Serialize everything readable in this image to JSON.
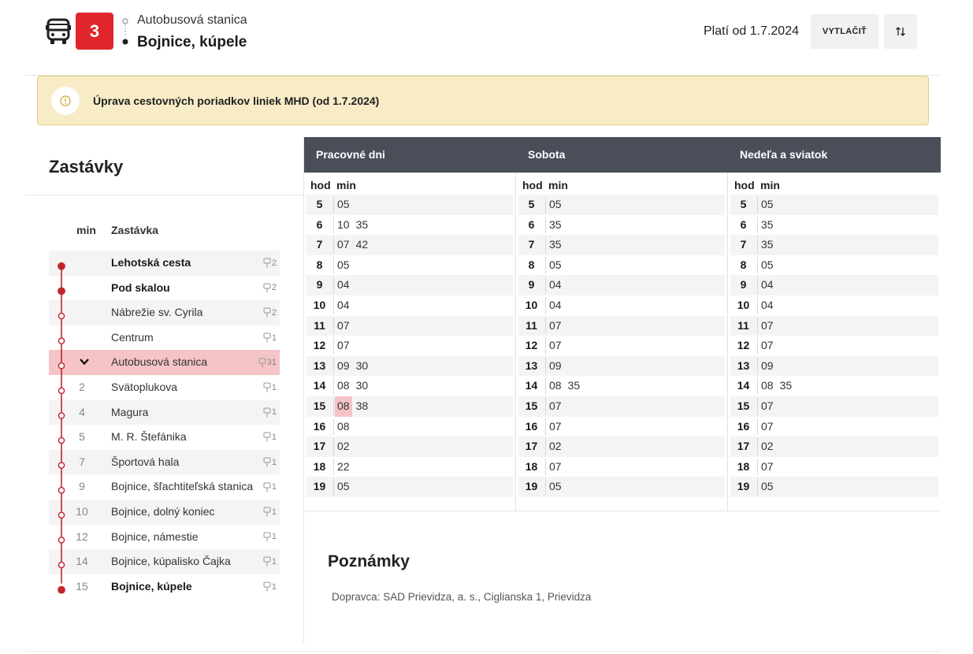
{
  "header": {
    "line_number": "3",
    "from_stop": "Autobusová stanica",
    "to_stop": "Bojnice, kúpele",
    "valid_from": "Platí od 1.7.2024",
    "print_label": "VYTLAČIŤ"
  },
  "notice": {
    "text": "Úprava cestovných poriadkov liniek MHD (od 1.7.2024)"
  },
  "stops": {
    "title": "Zastávky",
    "col_min": "min",
    "col_name": "Zastávka",
    "items": [
      {
        "min": "",
        "name": "Lehotská cesta",
        "platform": "2",
        "bold": true,
        "marker": "filled",
        "state": "past"
      },
      {
        "min": "",
        "name": "Pod skalou",
        "platform": "2",
        "bold": true,
        "marker": "filled",
        "state": "past"
      },
      {
        "min": "",
        "name": "Nábrežie sv. Cyrila",
        "platform": "2",
        "bold": false,
        "marker": "open",
        "state": "past"
      },
      {
        "min": "",
        "name": "Centrum",
        "platform": "1",
        "bold": false,
        "marker": "open",
        "state": "past"
      },
      {
        "min": "",
        "name": "Autobusová stanica",
        "platform": "31",
        "bold": false,
        "marker": "open",
        "state": "current"
      },
      {
        "min": "2",
        "name": "Svätoplukova",
        "platform": "1",
        "bold": false,
        "marker": "open",
        "state": "next"
      },
      {
        "min": "4",
        "name": "Magura",
        "platform": "1",
        "bold": false,
        "marker": "open",
        "state": "next"
      },
      {
        "min": "5",
        "name": "M. R. Štefánika",
        "platform": "1",
        "bold": false,
        "marker": "open",
        "state": "next"
      },
      {
        "min": "7",
        "name": "Športová hala",
        "platform": "1",
        "bold": false,
        "marker": "open",
        "state": "next"
      },
      {
        "min": "9",
        "name": "Bojnice, šľachtiteľská stanica",
        "platform": "1",
        "bold": false,
        "marker": "open",
        "state": "next"
      },
      {
        "min": "10",
        "name": "Bojnice, dolný koniec",
        "platform": "1",
        "bold": false,
        "marker": "open",
        "state": "next"
      },
      {
        "min": "12",
        "name": "Bojnice, námestie",
        "platform": "1",
        "bold": false,
        "marker": "open",
        "state": "next"
      },
      {
        "min": "14",
        "name": "Bojnice, kúpalisko Čajka",
        "platform": "1",
        "bold": false,
        "marker": "open",
        "state": "next"
      },
      {
        "min": "15",
        "name": "Bojnice, kúpele",
        "platform": "1",
        "bold": true,
        "marker": "filled",
        "state": "next"
      }
    ]
  },
  "timetable": {
    "hod_label": "hod",
    "min_label": "min",
    "columns": [
      {
        "title": "Pracovné dni",
        "rows": [
          {
            "hour": "5",
            "mins": [
              "05"
            ]
          },
          {
            "hour": "6",
            "mins": [
              "10",
              "35"
            ]
          },
          {
            "hour": "7",
            "mins": [
              "07",
              "42"
            ]
          },
          {
            "hour": "8",
            "mins": [
              "05"
            ]
          },
          {
            "hour": "9",
            "mins": [
              "04"
            ]
          },
          {
            "hour": "10",
            "mins": [
              "04"
            ]
          },
          {
            "hour": "11",
            "mins": [
              "07"
            ]
          },
          {
            "hour": "12",
            "mins": [
              "07"
            ]
          },
          {
            "hour": "13",
            "mins": [
              "09",
              "30"
            ]
          },
          {
            "hour": "14",
            "mins": [
              "08",
              "30"
            ]
          },
          {
            "hour": "15",
            "mins": [
              "08",
              "38"
            ],
            "highlight": "08"
          },
          {
            "hour": "16",
            "mins": [
              "08"
            ]
          },
          {
            "hour": "17",
            "mins": [
              "02"
            ]
          },
          {
            "hour": "18",
            "mins": [
              "22"
            ]
          },
          {
            "hour": "19",
            "mins": [
              "05"
            ]
          }
        ]
      },
      {
        "title": "Sobota",
        "rows": [
          {
            "hour": "5",
            "mins": [
              "05"
            ]
          },
          {
            "hour": "6",
            "mins": [
              "35"
            ]
          },
          {
            "hour": "7",
            "mins": [
              "35"
            ]
          },
          {
            "hour": "8",
            "mins": [
              "05"
            ]
          },
          {
            "hour": "9",
            "mins": [
              "04"
            ]
          },
          {
            "hour": "10",
            "mins": [
              "04"
            ]
          },
          {
            "hour": "11",
            "mins": [
              "07"
            ]
          },
          {
            "hour": "12",
            "mins": [
              "07"
            ]
          },
          {
            "hour": "13",
            "mins": [
              "09"
            ]
          },
          {
            "hour": "14",
            "mins": [
              "08",
              "35"
            ]
          },
          {
            "hour": "15",
            "mins": [
              "07"
            ]
          },
          {
            "hour": "16",
            "mins": [
              "07"
            ]
          },
          {
            "hour": "17",
            "mins": [
              "02"
            ]
          },
          {
            "hour": "18",
            "mins": [
              "07"
            ]
          },
          {
            "hour": "19",
            "mins": [
              "05"
            ]
          }
        ]
      },
      {
        "title": "Nedeľa a sviatok",
        "rows": [
          {
            "hour": "5",
            "mins": [
              "05"
            ]
          },
          {
            "hour": "6",
            "mins": [
              "35"
            ]
          },
          {
            "hour": "7",
            "mins": [
              "35"
            ]
          },
          {
            "hour": "8",
            "mins": [
              "05"
            ]
          },
          {
            "hour": "9",
            "mins": [
              "04"
            ]
          },
          {
            "hour": "10",
            "mins": [
              "04"
            ]
          },
          {
            "hour": "11",
            "mins": [
              "07"
            ]
          },
          {
            "hour": "12",
            "mins": [
              "07"
            ]
          },
          {
            "hour": "13",
            "mins": [
              "09"
            ]
          },
          {
            "hour": "14",
            "mins": [
              "08",
              "35"
            ]
          },
          {
            "hour": "15",
            "mins": [
              "07"
            ]
          },
          {
            "hour": "16",
            "mins": [
              "07"
            ]
          },
          {
            "hour": "17",
            "mins": [
              "02"
            ]
          },
          {
            "hour": "18",
            "mins": [
              "07"
            ]
          },
          {
            "hour": "19",
            "mins": [
              "05"
            ]
          }
        ]
      }
    ]
  },
  "notes": {
    "title": "Poznámky",
    "text": "Dopravca: SAD Prievidza, a. s., Ciglianska 1, Prievidza"
  },
  "icons": {
    "bus": "bus-icon",
    "info": "info-circle-icon",
    "swap": "swap-vertical-icon",
    "platform": "bus-stop-pole-icon",
    "chevron": "chevron-down-icon"
  },
  "colors": {
    "accent_red": "#e0262b",
    "route_red": "#c0262b",
    "current_stop_bg": "#f5c4c6",
    "notice_bg": "#f7ecc6",
    "table_header_bg": "#4a4e59"
  }
}
